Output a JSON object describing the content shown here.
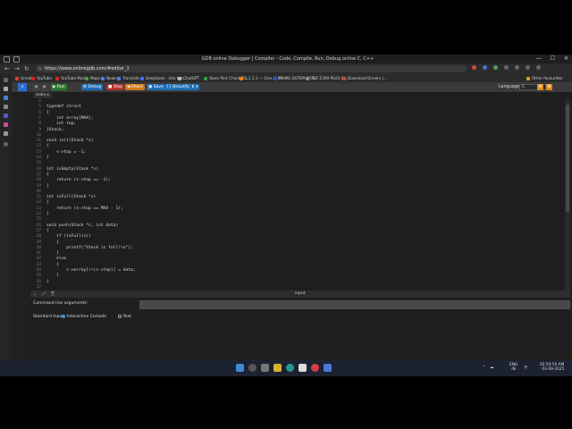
{
  "window": {
    "title": "GDB online Debugger | Compiler - Code, Compile, Run, Debug online C, C++",
    "minimize": "—",
    "maximize": "☐",
    "close": "✕"
  },
  "browser": {
    "url": "https://www.onlinegdb.com/#editor_1",
    "back": "←",
    "forward": "→",
    "reload": "↻",
    "bookmarks": [
      {
        "label": "Gmail",
        "color": "#d44638"
      },
      {
        "label": "YouTube",
        "color": "#e02020"
      },
      {
        "label": "YouTube Music",
        "color": "#e02020"
      },
      {
        "label": "Maps",
        "color": "#34a853"
      },
      {
        "label": "News",
        "color": "#4285f4"
      },
      {
        "label": "Translate",
        "color": "#4285f4"
      },
      {
        "label": "DeepSeek - Into the...",
        "color": "#4d6bfe"
      },
      {
        "label": "ChatGPT",
        "color": "#bbbbbb"
      },
      {
        "label": "Open Port Check To...",
        "color": "#3a9a3a"
      },
      {
        "label": "1.1.1.1 — One of th...",
        "color": "#f38020"
      },
      {
        "label": "PRIME QSTEM-C/CS...",
        "color": "#2a5ab0"
      },
      {
        "label": "TUF Z390-PLUS GA...",
        "color": "#888888"
      },
      {
        "label": "Download Drivers |...",
        "color": "#d04040"
      }
    ],
    "other_favourites": "Other favourites"
  },
  "toolbar": {
    "run": "Run",
    "debug": "Debug",
    "stop": "Stop",
    "share": "Share",
    "save": "Save",
    "beautify": "{} Beautify",
    "language_label": "Language",
    "language_value": "C"
  },
  "editor": {
    "file_tab": "main.c",
    "lines": [
      {
        "n": "4",
        "code": ""
      },
      {
        "n": "5",
        "code": "typedef struct"
      },
      {
        "n": "6",
        "code": "{"
      },
      {
        "n": "7",
        "code": "    int array[MAX];"
      },
      {
        "n": "8",
        "code": "    int top;"
      },
      {
        "n": "9",
        "code": "}Stack;"
      },
      {
        "n": "10",
        "code": ""
      },
      {
        "n": "11",
        "code": "void init(Stack *s)"
      },
      {
        "n": "12",
        "code": "{"
      },
      {
        "n": "13",
        "code": "    s->top = -1;"
      },
      {
        "n": "14",
        "code": "}"
      },
      {
        "n": "15",
        "code": ""
      },
      {
        "n": "16",
        "code": "int isEmpty(Stack *s)"
      },
      {
        "n": "17",
        "code": "{"
      },
      {
        "n": "18",
        "code": "    return (s->top == -1);"
      },
      {
        "n": "19",
        "code": "}"
      },
      {
        "n": "20",
        "code": ""
      },
      {
        "n": "21",
        "code": "int isFull(Stack *s)"
      },
      {
        "n": "22",
        "code": "{"
      },
      {
        "n": "23",
        "code": "    return (s->top == MAX - 1);"
      },
      {
        "n": "24",
        "code": "}"
      },
      {
        "n": "25",
        "code": ""
      },
      {
        "n": "26",
        "code": "void push(Stack *s, int data)"
      },
      {
        "n": "27",
        "code": "{"
      },
      {
        "n": "28",
        "code": "    if (isFull(s))"
      },
      {
        "n": "29",
        "code": "    {"
      },
      {
        "n": "30",
        "code": "        printf(\"Stack is full!\\n\");"
      },
      {
        "n": "31",
        "code": "    }"
      },
      {
        "n": "32",
        "code": "    else"
      },
      {
        "n": "33",
        "code": "    {"
      },
      {
        "n": "34",
        "code": "        s->array[++(s->top)] = data;"
      },
      {
        "n": "35",
        "code": "    }"
      },
      {
        "n": "36",
        "code": "}"
      },
      {
        "n": "37",
        "code": ""
      }
    ]
  },
  "io_panel": {
    "header": "input",
    "command_line_label": "Command line arguments:",
    "standard_input_label": "Standard Input:",
    "option_interactive": "Interactive Console",
    "option_text": "Text"
  },
  "taskbar": {
    "lang": "ENG",
    "region": "IN",
    "time": "02:50:50 AM",
    "date": "03-09-2025"
  }
}
